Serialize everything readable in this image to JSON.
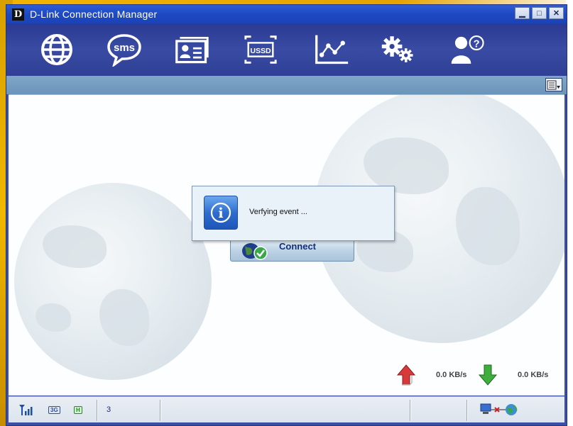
{
  "window": {
    "title": "D-Link Connection Manager",
    "logo_letter": "D",
    "controls": {
      "minimize": "▁",
      "maximize": "□",
      "close": "✕"
    }
  },
  "toolbar": {
    "items": [
      {
        "name": "internet",
        "icon": "globe-icon"
      },
      {
        "name": "sms",
        "icon": "sms-icon",
        "label": "sms"
      },
      {
        "name": "contacts",
        "icon": "contact-card-icon"
      },
      {
        "name": "ussd",
        "icon": "ussd-icon",
        "label": "USSD"
      },
      {
        "name": "statistics",
        "icon": "chart-icon"
      },
      {
        "name": "settings",
        "icon": "gears-icon"
      },
      {
        "name": "help",
        "icon": "user-help-icon",
        "label": "?"
      }
    ]
  },
  "main": {
    "connect_label": "Connect",
    "dialog": {
      "icon": "info-icon",
      "icon_glyph": "i",
      "message": "Verfying event ..."
    },
    "upload": {
      "icon": "upload-arrow-icon",
      "value": "0.0 KB/s"
    },
    "download": {
      "icon": "download-arrow-icon",
      "value": "0.0 KB/s"
    }
  },
  "status": {
    "signal_icon": "signal-strength-icon",
    "network_badge": "3G",
    "hspa_badge": "H",
    "count": "3",
    "network_status_icon": "network-disconnected-icon"
  },
  "colors": {
    "titlebar": "#1e49c2",
    "toolbar": "#2f3f95",
    "subbar": "#6b94ba",
    "dialog_bg": "#e9f2f9",
    "connect_text": "#0f2f7a"
  }
}
